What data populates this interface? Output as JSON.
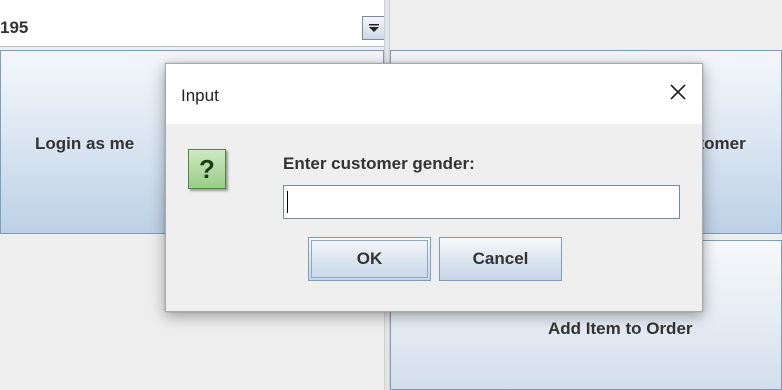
{
  "background": {
    "combo_value": "195",
    "login_button": "Login as me",
    "customer_button": "stomer",
    "add_item_button": "Add Item to Order"
  },
  "dialog": {
    "title": "Input",
    "prompt": "Enter customer gender:",
    "input_value": "",
    "ok_label": "OK",
    "cancel_label": "Cancel",
    "icon_glyph": "?"
  },
  "icons": {
    "close": "close-icon",
    "question": "question-icon",
    "combo_arrow": "chevron-down-icon"
  }
}
